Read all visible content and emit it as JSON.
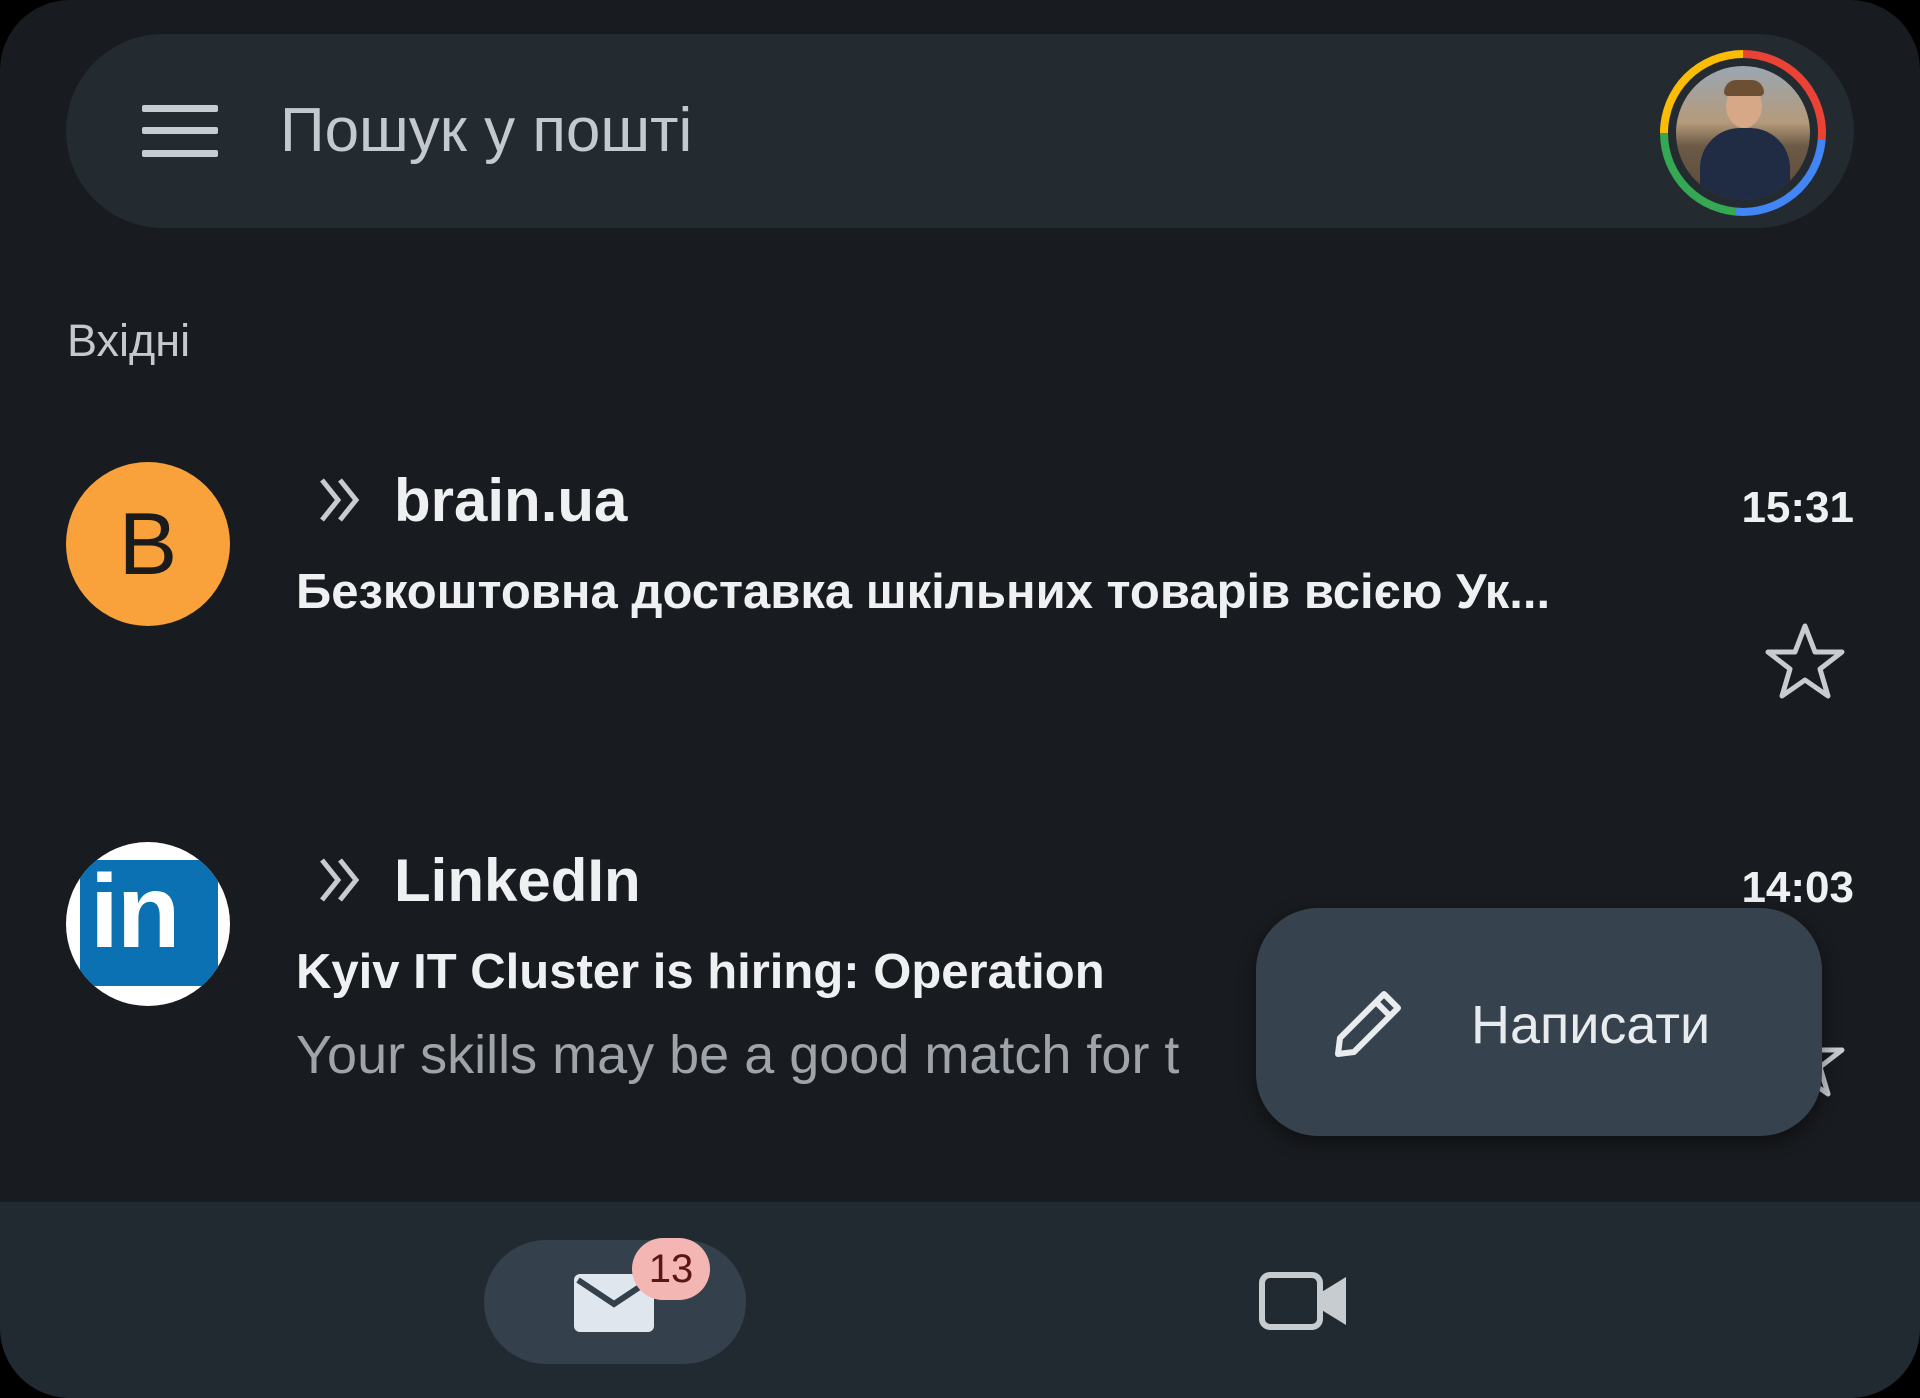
{
  "search": {
    "placeholder": "Пошук у пошті"
  },
  "section": {
    "label": "Вхідні"
  },
  "mails": [
    {
      "avatar_letter": "B",
      "avatar_color": "#f9a13b",
      "sender": "brain.ua",
      "time": "15:31",
      "subject": "Безкоштовна доставка шкільних товарів всією Ук...",
      "snippet": "",
      "starred": false,
      "important_icon": "priority-chevrons-icon"
    },
    {
      "avatar_logo": "in",
      "avatar_color": "#0b71b2",
      "sender": "LinkedIn",
      "time": "14:03",
      "subject": "Kyiv IT Cluster is hiring: Operation",
      "snippet": "Your skills may be a good match for t",
      "starred": false,
      "important_icon": "priority-chevrons-icon"
    }
  ],
  "compose": {
    "label": "Написати",
    "icon": "pencil-icon"
  },
  "bottom_nav": {
    "mail": {
      "icon": "mail-icon",
      "badge": "13",
      "active": true
    },
    "meet": {
      "icon": "video-camera-icon",
      "active": false
    }
  },
  "colors": {
    "background": "#181b1f",
    "surface": "#232b31",
    "fab": "#36434e",
    "badge": "#f4b6b2"
  }
}
